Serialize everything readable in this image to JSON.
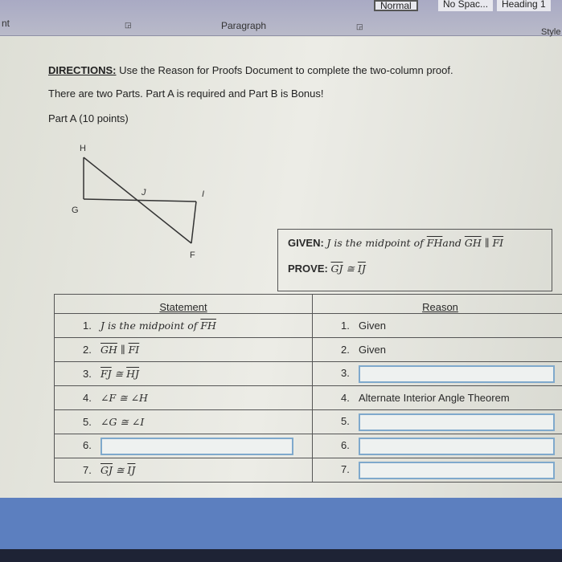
{
  "ribbon": {
    "font_group_partial": "nt",
    "paragraph_group": "Paragraph",
    "styles_group_partial": "Style",
    "styles": [
      "Normal",
      "No Spac...",
      "Heading 1"
    ]
  },
  "document": {
    "directions_label": "DIRECTIONS:",
    "directions_text": " Use the Reason for Proofs Document to complete the two-column proof.",
    "parts_text": "There are two Parts. Part A is required and Part B is Bonus!",
    "part_a": "Part A (10 points)",
    "diagram_labels": {
      "H": "H",
      "G": "G",
      "J": "J",
      "I": "I",
      "F": "F"
    },
    "given": {
      "label": "GIVEN:",
      "segments": [
        {
          "t": "J is the midpoint of ",
          "o": false
        },
        {
          "t": "FH",
          "o": true
        },
        {
          "t": "and ",
          "o": false
        },
        {
          "t": "GH",
          "o": true
        },
        {
          "t": " ∥ ",
          "o": false
        },
        {
          "t": "FI",
          "o": true
        }
      ]
    },
    "prove": {
      "label": "PROVE:",
      "segments": [
        {
          "t": "GJ",
          "o": true
        },
        {
          "t": " ≅ ",
          "o": false
        },
        {
          "t": "IJ",
          "o": true
        }
      ]
    },
    "table": {
      "headers": [
        "Statement",
        "Reason"
      ],
      "rows": [
        {
          "num": "1.",
          "statement": [
            {
              "t": "J is the midpoint of ",
              "o": false
            },
            {
              "t": "FH",
              "o": true
            }
          ],
          "reason_num": "1.",
          "reason": "Given"
        },
        {
          "num": "2.",
          "statement": [
            {
              "t": "GH",
              "o": true
            },
            {
              "t": " ∥ ",
              "o": false
            },
            {
              "t": "FI",
              "o": true
            }
          ],
          "reason_num": "2.",
          "reason": "Given"
        },
        {
          "num": "3.",
          "statement": [
            {
              "t": "FJ",
              "o": true
            },
            {
              "t": " ≅ ",
              "o": false
            },
            {
              "t": "HJ",
              "o": true
            }
          ],
          "reason_num": "3.",
          "reason": null
        },
        {
          "num": "4.",
          "statement": [
            {
              "t": "∠F ≅ ∠H",
              "o": false
            }
          ],
          "reason_num": "4.",
          "reason": "Alternate Interior Angle Theorem"
        },
        {
          "num": "5.",
          "statement": [
            {
              "t": "∠G ≅ ∠I",
              "o": false
            }
          ],
          "reason_num": "5.",
          "reason": null
        },
        {
          "num": "6.",
          "statement": null,
          "reason_num": "6.",
          "reason": null
        },
        {
          "num": "7.",
          "statement": [
            {
              "t": "GJ",
              "o": true
            },
            {
              "t": " ≅ ",
              "o": false
            },
            {
              "t": "IJ",
              "o": true
            }
          ],
          "reason_num": "7.",
          "reason": null
        }
      ]
    }
  },
  "colors": {
    "field_border": "#7fa9cc",
    "ribbon": "#b0b1c6",
    "taskbar": "#5c7fbf"
  }
}
